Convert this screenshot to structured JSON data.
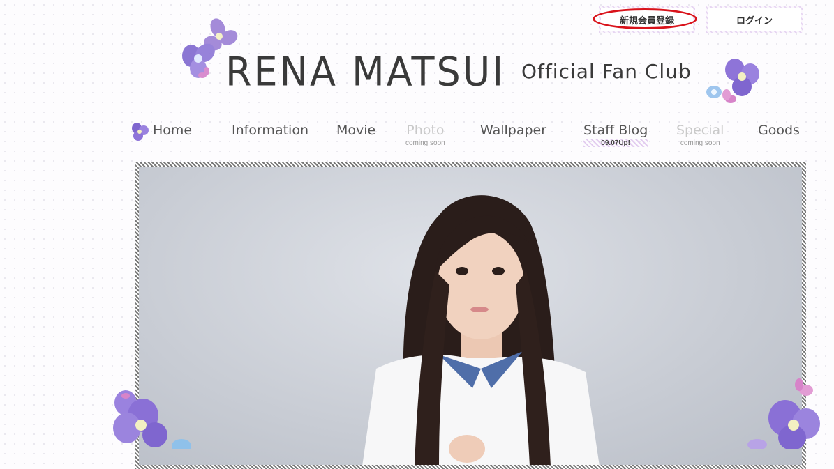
{
  "header": {
    "register_label": "新規会員登録",
    "login_label": "ログイン",
    "logo_main": "RENA MATSUI",
    "logo_sub": "Official Fan Club"
  },
  "nav": {
    "items": [
      {
        "label": "Home",
        "sub": ""
      },
      {
        "label": "Information",
        "sub": ""
      },
      {
        "label": "Movie",
        "sub": ""
      },
      {
        "label": "Photo",
        "sub": "coming soon"
      },
      {
        "label": "Wallpaper",
        "sub": ""
      },
      {
        "label": "Staff Blog",
        "sub": "09.07Up!"
      },
      {
        "label": "Special",
        "sub": "coming soon"
      },
      {
        "label": "Goods",
        "sub": ""
      }
    ]
  },
  "colors": {
    "accent_purple": "#9b7fd6",
    "highlight_red": "#d9131b",
    "text": "#3a3a3a"
  },
  "icons": [
    "flower-icon"
  ]
}
